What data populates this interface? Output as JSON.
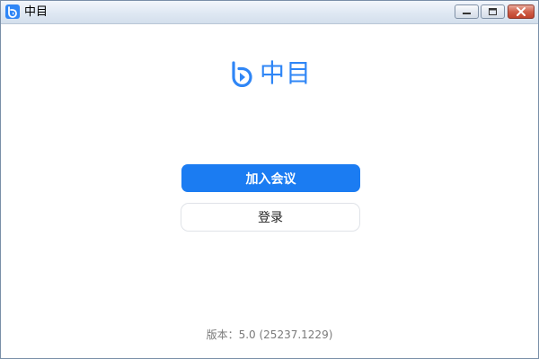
{
  "window": {
    "title": "中目",
    "icon": "zhongmu-logo-icon",
    "controls": {
      "minimize_icon": "minimize-icon",
      "maximize_icon": "maximize-icon",
      "close_icon": "close-icon"
    }
  },
  "brand": {
    "name": "中目",
    "logo_icon": "zhongmu-logo-icon",
    "color": "#2f86f6"
  },
  "actions": {
    "join_meeting_label": "加入会议",
    "login_label": "登录",
    "primary_color": "#1b7cf2"
  },
  "footer": {
    "version_text": "版本：5.0 (25237.1229)"
  }
}
